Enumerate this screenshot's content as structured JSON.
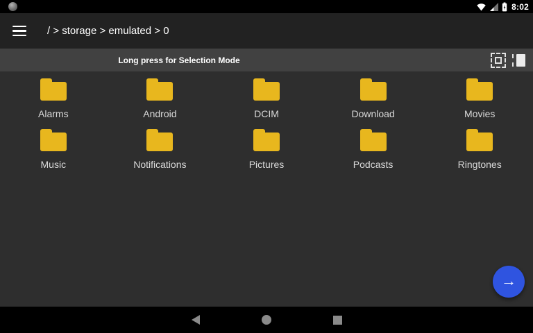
{
  "colors": {
    "background": "#2E2E2E",
    "appbar": "#222222",
    "selection_bar": "#414141",
    "statusbar": "#000000",
    "navbar": "#000000",
    "folder_yellow": "#E8B71E",
    "fab_blue": "#2F54E0",
    "label_gray": "#D9D9D9"
  },
  "status_bar": {
    "time": "8:02",
    "icons": [
      "notification-dot-icon",
      "wifi-icon",
      "cell-signal-icon",
      "battery-charging-icon"
    ]
  },
  "toolbar": {
    "menu_icon": "hamburger-menu-icon",
    "breadcrumb": "/ > storage > emulated > 0"
  },
  "selection_bar": {
    "hint": "Long press for Selection Mode",
    "icons": [
      "select-all-icon",
      "select-side-panel-icon"
    ]
  },
  "folders": [
    "Alarms",
    "Android",
    "DCIM",
    "Download",
    "Movies",
    "Music",
    "Notifications",
    "Pictures",
    "Podcasts",
    "Ringtones"
  ],
  "fab": {
    "arrow": "→"
  },
  "nav_bar": {
    "icons": [
      "back-icon",
      "home-icon",
      "recents-icon"
    ]
  }
}
